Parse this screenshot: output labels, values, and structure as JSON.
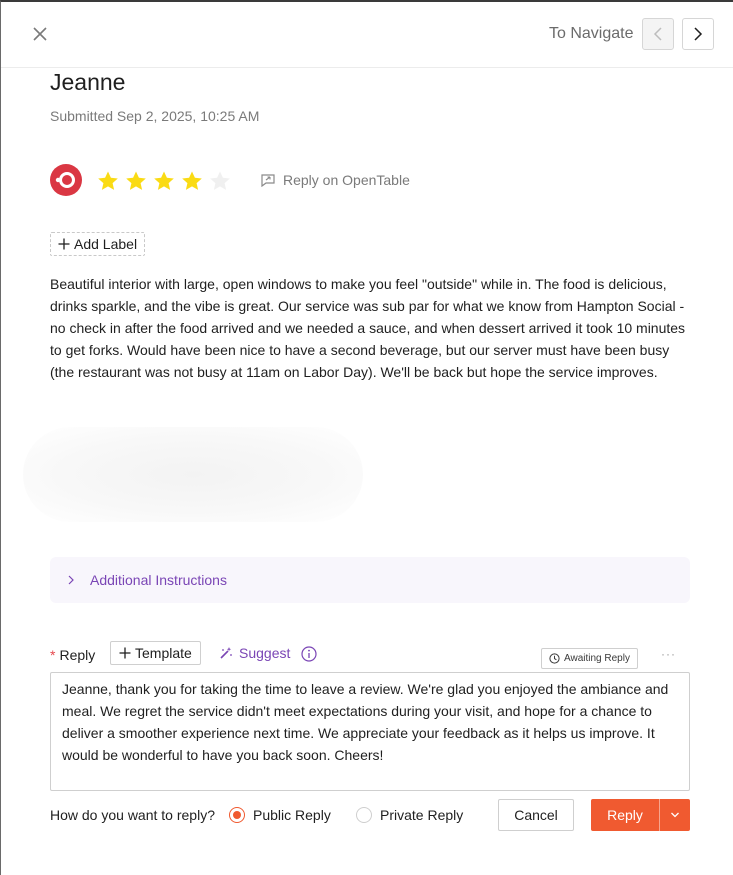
{
  "header": {
    "nav_label": "To Navigate"
  },
  "review": {
    "reviewer_name": "Jeanne",
    "submitted": "Submitted Sep 2, 2025, 10:25 AM",
    "rating": 4,
    "rating_max": 5,
    "source_icon": "opentable-logo",
    "reply_on_label": "Reply on OpenTable",
    "add_label": "Add Label",
    "text": "Beautiful interior with large, open windows to make you feel \"outside\" while in. The food is delicious, drinks sparkle, and the vibe is great. Our service was sub par for what we know from Hampton Social - no check in after the food arrived and we needed a sauce, and when dessert arrived it took 10 minutes to get forks. Would have been nice to have a second beverage, but our server must have been busy (the restaurant was not busy at 11am on Labor Day). We'll be back but hope the service improves."
  },
  "instructions": {
    "label": "Additional Instructions"
  },
  "reply": {
    "required_mark": "*",
    "label": "Reply",
    "template_label": "Template",
    "suggest_label": "Suggest",
    "status": "Awaiting Reply",
    "more": "···",
    "text": "Jeanne, thank you for taking the time to leave a review. We're glad you enjoyed the ambiance and meal. We regret the service didn't meet expectations during your visit, and hope for a chance to deliver a smoother experience next time. We appreciate your feedback as it helps us improve. It would be wonderful to have you back soon. Cheers!",
    "how_label": "How do you want to reply?",
    "public_label": "Public Reply",
    "private_label": "Private Reply",
    "selected": "public",
    "cancel_label": "Cancel",
    "submit_label": "Reply"
  },
  "colors": {
    "accent": "#f05a30",
    "purple": "#7a45b5",
    "star": "#fadb14",
    "star_empty": "#f0f0f0",
    "opentable": "#da3743"
  }
}
